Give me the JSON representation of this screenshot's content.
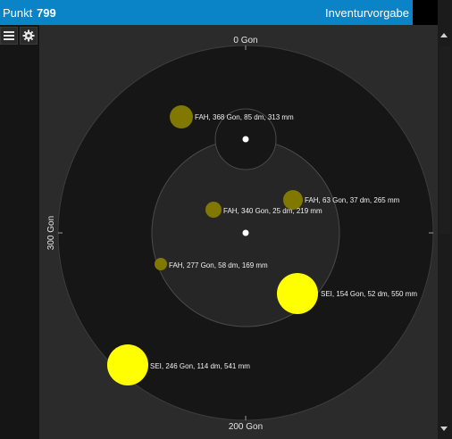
{
  "header": {
    "point_label": "Punkt",
    "point_number": "799",
    "mode_label": "Inventurvorgabe"
  },
  "toolbar": {
    "menu_icon": "hamburger-menu-icon",
    "settings_icon": "gear-icon"
  },
  "plot": {
    "axis_labels": {
      "top": "0 Gon",
      "bottom": "200 Gon",
      "left": "300 Gon"
    },
    "objects": [
      {
        "label": "FAH, 368 Gon, 85 dm, 313 mm",
        "color": "#807800"
      },
      {
        "label": "FAH, 63 Gon, 37 dm, 265 mm",
        "color": "#807800"
      },
      {
        "label": "FAH, 340 Gon, 25 dm, 219 mm",
        "color": "#807800"
      },
      {
        "label": "FAH, 277 Gon, 58 dm, 169 mm",
        "color": "#807800"
      },
      {
        "label": "SEI, 154 Gon, 52 dm, 550 mm",
        "color": "#ffff00"
      },
      {
        "label": "SEI, 246 Gon, 114 dm, 541 mm",
        "color": "#ffff00"
      }
    ]
  },
  "colors": {
    "header_bg": "#0a84c7",
    "outer_ring": "#161616",
    "inner_ring": "#262626",
    "fah_fill": "#807800",
    "sei_fill": "#ffff00"
  }
}
